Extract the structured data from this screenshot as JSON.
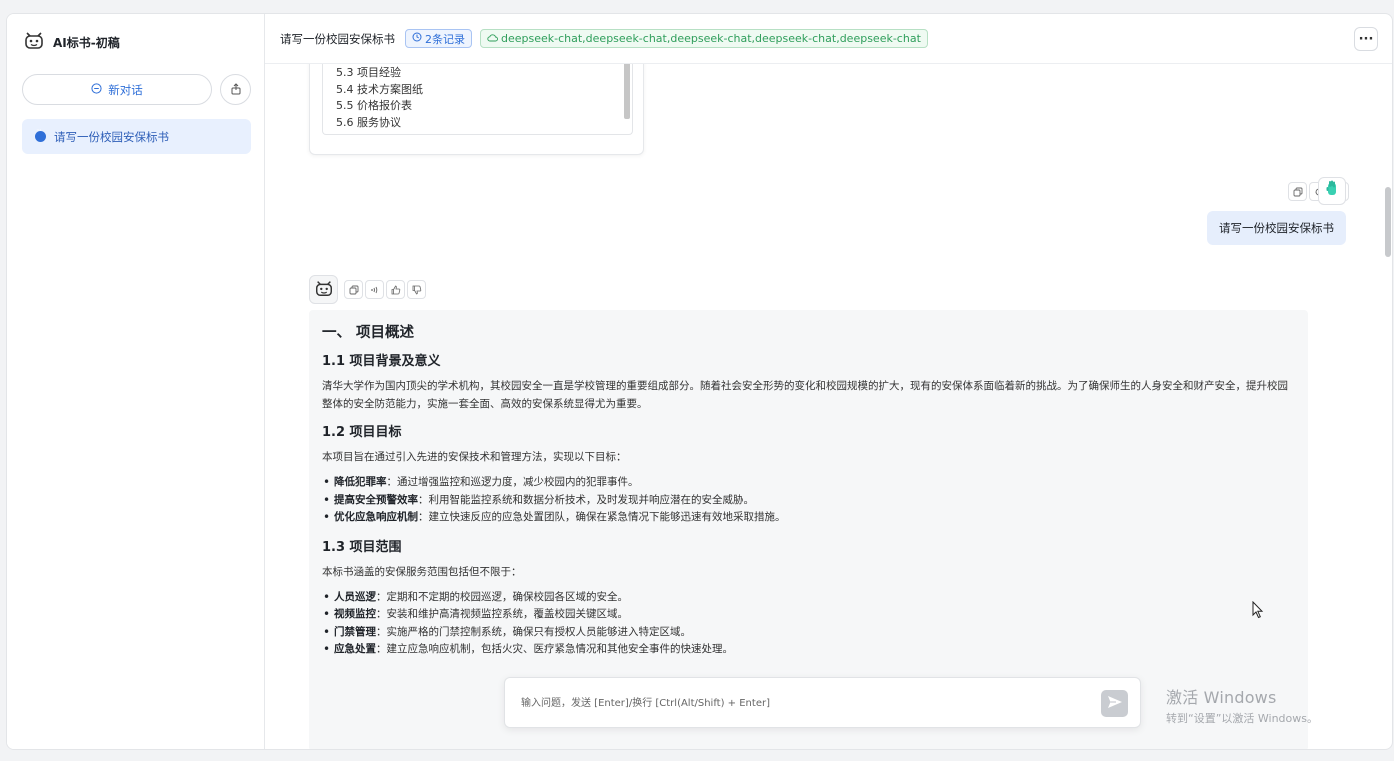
{
  "sidebar": {
    "app_name": "AI标书-初稿",
    "new_chat_label": "新对话",
    "conversations": [
      {
        "label": "请写一份校园安保标书"
      }
    ]
  },
  "header": {
    "title": "请写一份校园安保标书",
    "records_badge": "2条记录",
    "models_badge": "deepseek-chat,deepseek-chat,deepseek-chat,deepseek-chat,deepseek-chat"
  },
  "toc": {
    "items": [
      "5.3 项目经验",
      "5.4 技术方案图纸",
      "5.5 价格报价表",
      "5.6 服务协议"
    ]
  },
  "user_message": "请写一份校园安保标书",
  "answer": {
    "h1": "一、 项目概述",
    "s1_title": "1.1 项目背景及意义",
    "s1_text": "清华大学作为国内顶尖的学术机构，其校园安全一直是学校管理的重要组成部分。随着社会安全形势的变化和校园规模的扩大，现有的安保体系面临着新的挑战。为了确保师生的人身安全和财产安全，提升校园整体的安全防范能力，实施一套全面、高效的安保系统显得尤为重要。",
    "s2_title": "1.2 项目目标",
    "s2_text": "本项目旨在通过引入先进的安保技术和管理方法，实现以下目标：",
    "s2_items": [
      {
        "term": "降低犯罪率",
        "desc": "：通过增强监控和巡逻力度，减少校园内的犯罪事件。"
      },
      {
        "term": "提高安全预警效率",
        "desc": "：利用智能监控系统和数据分析技术，及时发现并响应潜在的安全威胁。"
      },
      {
        "term": "优化应急响应机制",
        "desc": "：建立快速反应的应急处置团队，确保在紧急情况下能够迅速有效地采取措施。"
      }
    ],
    "s3_title": "1.3 项目范围",
    "s3_text": "本标书涵盖的安保服务范围包括但不限于：",
    "s3_items": [
      {
        "term": "人员巡逻",
        "desc": "：定期和不定期的校园巡逻，确保校园各区域的安全。"
      },
      {
        "term": "视频监控",
        "desc": "：安装和维护高清视频监控系统，覆盖校园关键区域。"
      },
      {
        "term": "门禁管理",
        "desc": "：实施严格的门禁控制系统，确保只有授权人员能够进入特定区域。"
      },
      {
        "term": "应急处置",
        "desc": "：建立应急响应机制，包括火灾、医疗紧急情况和其他安全事件的快速处理。"
      }
    ]
  },
  "input": {
    "placeholder": "输入问题，发送 [Enter]/换行 [Ctrl(Alt/Shift) + Enter]",
    "value": ""
  },
  "watermark": {
    "line1": "激活 Windows",
    "line2": "转到“设置”以激活 Windows。"
  },
  "icons": {
    "brand": "robot-icon",
    "new_chat": "chat-bubble-icon",
    "share": "share-icon",
    "records": "clock-icon",
    "models": "cloud-icon",
    "more": "more-icon",
    "copy": "copy-icon",
    "regenerate": "refresh-icon",
    "delete": "trash-icon",
    "speak": "speaker-icon",
    "like": "thumbs-up-icon",
    "dislike": "thumbs-down-icon",
    "send": "send-icon"
  },
  "colors": {
    "accent": "#2f6fd8",
    "success": "#2f9e5b",
    "user_bubble": "#e6eefc",
    "answer_bg": "#f6f7f8"
  }
}
